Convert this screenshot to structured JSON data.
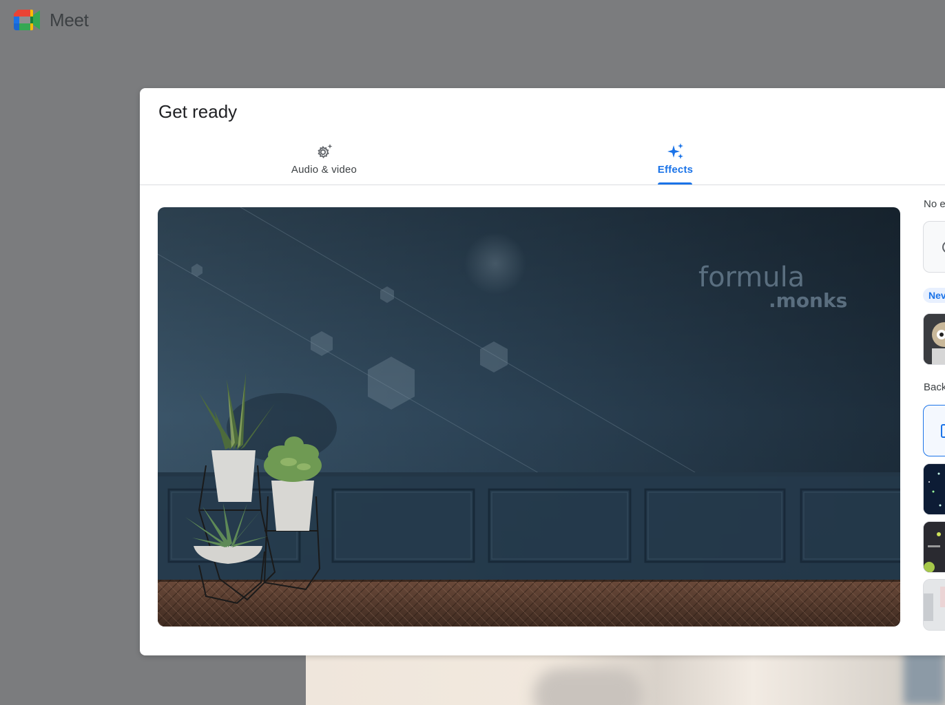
{
  "app": {
    "name": "Meet"
  },
  "dialog": {
    "title": "Get ready",
    "tabs": [
      {
        "label": "Audio & video",
        "icon": "settings-sparkle-icon",
        "selected": false
      },
      {
        "label": "Effects",
        "icon": "sparkle-icon",
        "selected": true
      }
    ]
  },
  "preview": {
    "watermark_line1": "formula",
    "watermark_line2": ".monks"
  },
  "effects_panel": {
    "section_no_effects": "No e",
    "new_badge": "Nev",
    "section_backgrounds": "Back"
  },
  "colors": {
    "accent": "#1a73e8",
    "page_bg": "#7b7c7e",
    "wall": "#2f4456"
  }
}
